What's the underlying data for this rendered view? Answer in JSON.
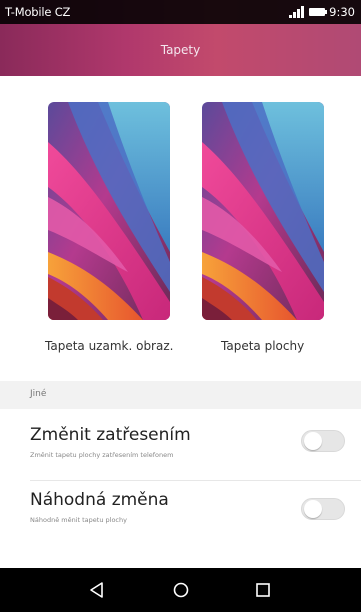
{
  "status_bar": {
    "carrier": "T-Mobile CZ",
    "time": "9:30",
    "signal_icon": "signal-icon",
    "battery_icon": "battery-icon"
  },
  "header": {
    "title": "Tapety",
    "color": "#b0386c"
  },
  "previews": [
    {
      "label": "Tapeta uzamk. obraz."
    },
    {
      "label": "Tapeta plochy"
    }
  ],
  "section": {
    "label": "Jiné"
  },
  "settings": [
    {
      "title": "Změnit zatřesením",
      "subtitle": "Změnit tapetu plochy zatřesením telefonem",
      "enabled": false
    },
    {
      "title": "Náhodná změna",
      "subtitle": "Náhodně měnit tapetu plochy",
      "enabled": false
    }
  ],
  "nav_bar": {
    "back_icon": "back-icon",
    "home_icon": "home-icon",
    "recents_icon": "recents-icon"
  }
}
